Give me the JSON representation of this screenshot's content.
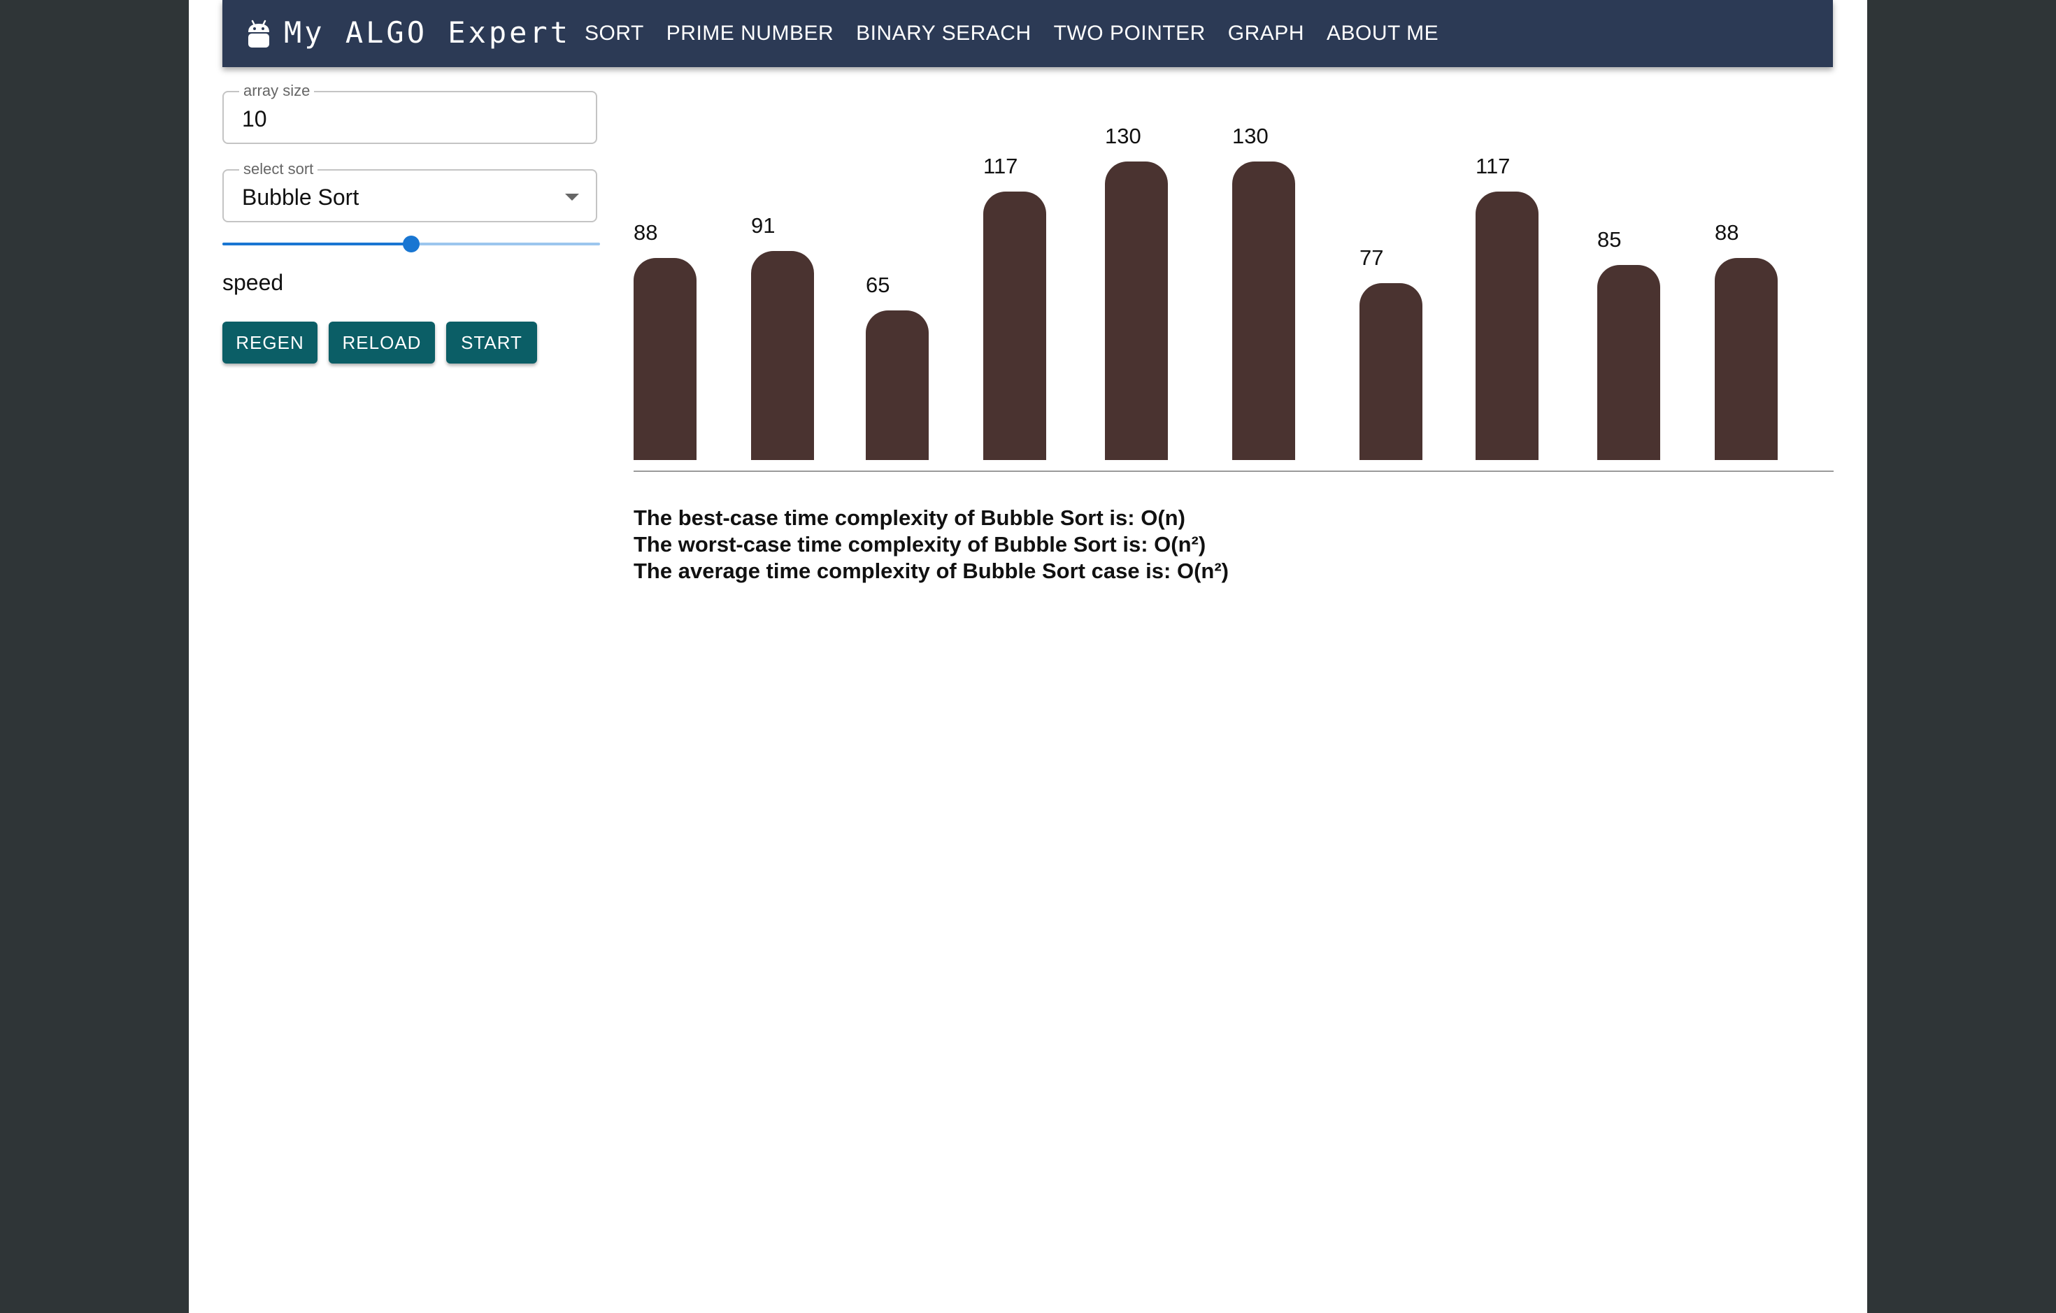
{
  "header": {
    "brand": "My ALGO Expert",
    "logo_icon": "android-icon",
    "nav": [
      "SORT",
      "PRIME NUMBER",
      "BINARY SERACH",
      "TWO POINTER",
      "GRAPH",
      "ABOUT ME"
    ]
  },
  "controls": {
    "array_size": {
      "label": "array size",
      "value": "10"
    },
    "select_sort": {
      "label": "select sort",
      "value": "Bubble Sort",
      "icon": "chevron-down-icon"
    },
    "speed": {
      "label": "speed",
      "value_fraction": 0.5
    },
    "buttons": {
      "regen": "REGEN",
      "reload": "RELOAD",
      "start": "START"
    }
  },
  "chart_data": {
    "type": "bar",
    "values": [
      88,
      91,
      65,
      117,
      130,
      130,
      77,
      117,
      85,
      88
    ],
    "ylim": [
      0,
      140
    ],
    "bar_color": "#4a3330"
  },
  "complexity": {
    "best": "The best-case time complexity of Bubble Sort is: O(n)",
    "worst": "The worst-case time complexity of Bubble Sort is: O(n²)",
    "average": "The average time complexity of Bubble Sort case is: O(n²)"
  },
  "colors": {
    "appbar": "#2c3a55",
    "button": "#0b5e66",
    "slider": "#1976d2",
    "outer_background": "#2f3537"
  }
}
